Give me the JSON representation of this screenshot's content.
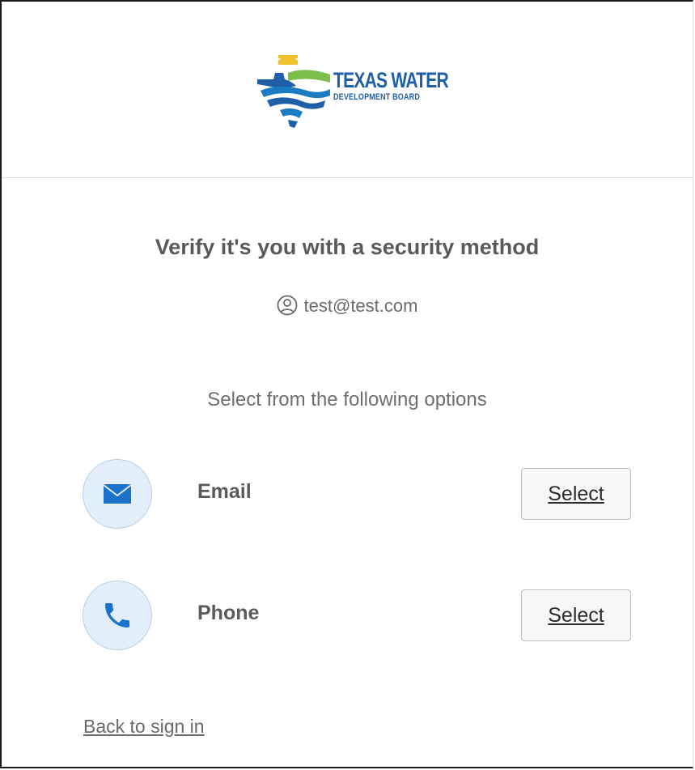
{
  "logo": {
    "title": "TEXAS WATER",
    "subtitle": "DEVELOPMENT BOARD",
    "icon": "texas-water-logo-icon"
  },
  "title": "Verify it's you with a security method",
  "identifier": {
    "icon": "user-circle-icon",
    "value": "test@test.com"
  },
  "subtitle": "Select from the following options",
  "options": [
    {
      "label": "Email",
      "icon": "envelope-icon",
      "button": "Select"
    },
    {
      "label": "Phone",
      "icon": "phone-icon",
      "button": "Select"
    }
  ],
  "back_link": "Back to sign in",
  "colors": {
    "brand_blue": "#1f5fa8",
    "icon_bg": "#e3eefb",
    "icon_blue": "#1a73c8",
    "text": "#5a5a5a"
  }
}
